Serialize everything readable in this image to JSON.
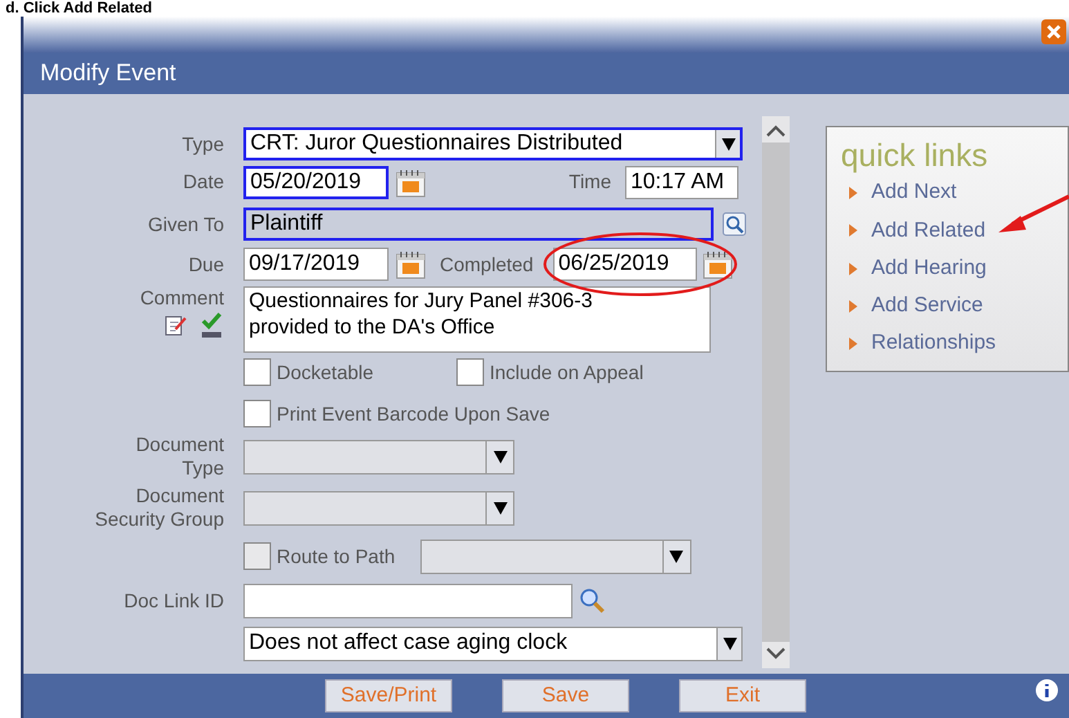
{
  "heading": "d.   Click Add Related",
  "window": {
    "title": "Modify Event"
  },
  "form": {
    "type": {
      "label": "Type",
      "value": "CRT: Juror Questionnaires Distributed",
      "required": true
    },
    "date": {
      "label": "Date",
      "value": "05/20/2019",
      "required": true
    },
    "time": {
      "label": "Time",
      "value": "10:17 AM"
    },
    "given_to": {
      "label": "Given To",
      "value": "Plaintiff",
      "required": true
    },
    "due": {
      "label": "Due",
      "value": "09/17/2019",
      "required": false
    },
    "completed": {
      "label": "Completed",
      "value": "06/25/2019"
    },
    "comment": {
      "label": "Comment",
      "value": "Questionnaires for Jury Panel #306-3\nprovided to the DA's Office"
    },
    "flags": [
      {
        "label": "Docketable",
        "checked": false
      },
      {
        "label": "Include on Appeal",
        "checked": false
      }
    ],
    "print_barcode": {
      "label": "Print Event Barcode Upon Save",
      "checked": false
    },
    "document_type": {
      "label": [
        "Document",
        "Type"
      ]
    },
    "document_security_group": {
      "label": [
        "Document",
        "Security Group"
      ]
    },
    "route_to_path": {
      "label": "Route to Path",
      "checked": false
    },
    "doc_link_id": {
      "label": "Doc Link ID"
    },
    "aging": {
      "value": "Does not affect case aging clock"
    }
  },
  "quick_links": {
    "title": "quick links",
    "items": [
      "Add Next",
      "Add Related",
      "Add Hearing",
      "Add Service",
      "Relationships"
    ]
  },
  "buttons": [
    "Save/Print",
    "Save",
    "Exit"
  ]
}
